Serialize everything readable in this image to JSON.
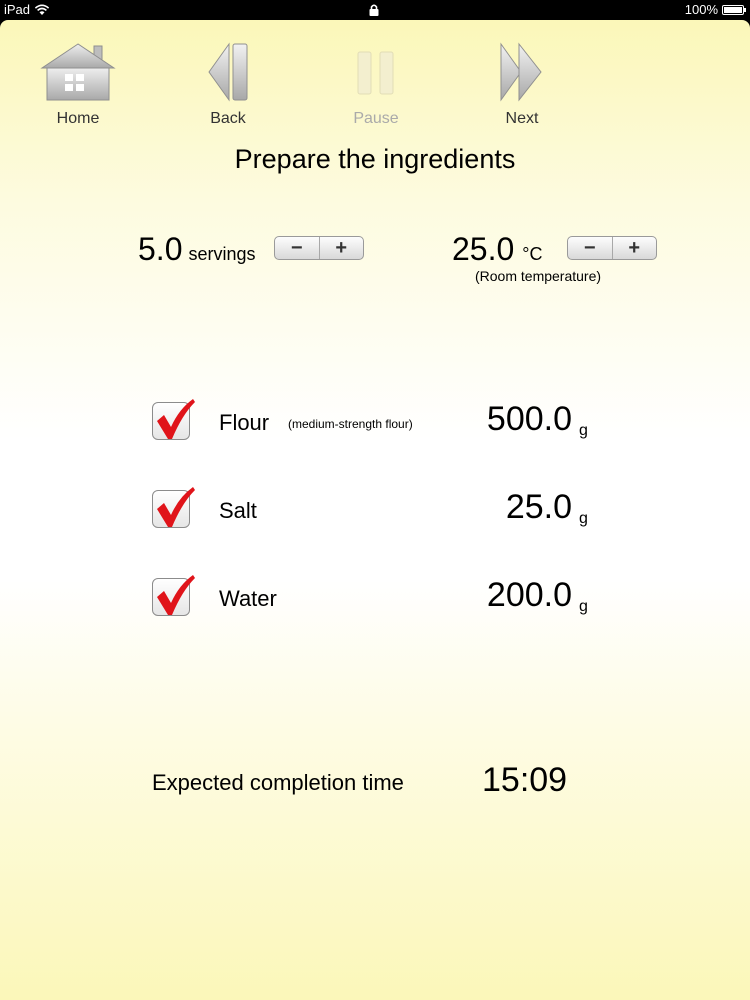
{
  "status_bar": {
    "device": "iPad",
    "battery": "100%",
    "battery_level": 1.0
  },
  "toolbar": {
    "home_label": "Home",
    "back_label": "Back",
    "pause_label": "Pause",
    "next_label": "Next"
  },
  "title": "Prepare the ingredients",
  "servings": {
    "value": "5.0",
    "unit": "servings",
    "minus": "−",
    "plus": "+"
  },
  "temperature": {
    "value": "25.0",
    "unit": "°C",
    "note": "(Room temperature)",
    "minus": "−",
    "plus": "+"
  },
  "ingredients": [
    {
      "name": "Flour",
      "note": "(medium-strength flour)",
      "amount": "500.0",
      "unit": "g",
      "checked": true
    },
    {
      "name": "Salt",
      "note": "",
      "amount": "25.0",
      "unit": "g",
      "checked": true
    },
    {
      "name": "Water",
      "note": "",
      "amount": "200.0",
      "unit": "g",
      "checked": true
    }
  ],
  "completion": {
    "label": "Expected completion time",
    "time": "15:09"
  },
  "colors": {
    "background_top": "#fbf7b9",
    "check_red": "#e0141a"
  }
}
